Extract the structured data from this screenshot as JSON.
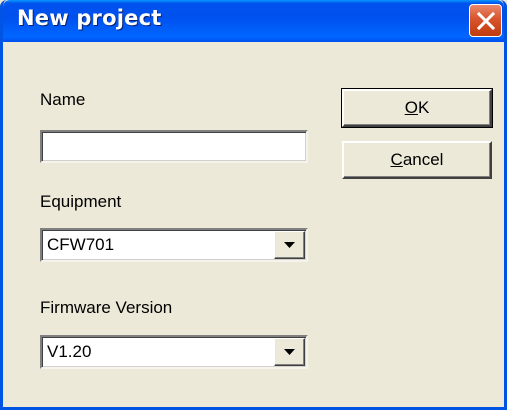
{
  "window": {
    "title": "New project"
  },
  "form": {
    "name_label": "Name",
    "name_value": "",
    "equipment_label": "Equipment",
    "equipment_value": "CFW701",
    "firmware_label": "Firmware Version",
    "firmware_value": "V1.20"
  },
  "buttons": {
    "ok_mnemonic": "O",
    "ok_rest": "K",
    "cancel_mnemonic": "C",
    "cancel_rest": "ancel"
  },
  "icons": {
    "close": "close-icon",
    "dropdown": "chevron-down-icon"
  },
  "colors": {
    "titlebar": "#0054e3",
    "close_button": "#d9532c",
    "dialog_background": "#ece9d8"
  }
}
